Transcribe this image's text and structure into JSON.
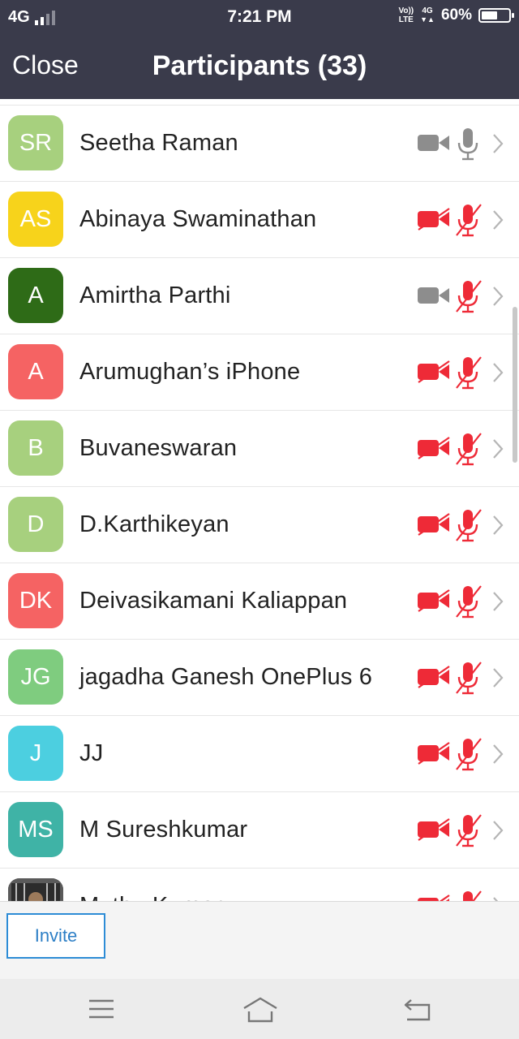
{
  "status_bar": {
    "network": "4G",
    "time": "7:21 PM",
    "volte_top": "Vo))",
    "volte_bottom": "LTE",
    "net_right": "4G",
    "battery": "60%",
    "battery_level": 0.6
  },
  "header": {
    "close_label": "Close",
    "title": "Participants (33)"
  },
  "colors": {
    "header_bg": "#3a3b4b",
    "muted_red": "#ee2a37",
    "active_gray": "#8d8d8d",
    "invite_blue": "#2d8cd6"
  },
  "participants": [
    {
      "initials": "SR",
      "name": "Seetha Raman",
      "avatar_color": "#a7d07e",
      "video": "on",
      "audio": "on"
    },
    {
      "initials": "AS",
      "name": "Abinaya Swaminathan",
      "avatar_color": "#f7d31b",
      "video": "off",
      "audio": "off"
    },
    {
      "initials": "A",
      "name": "Amirtha Parthi",
      "avatar_color": "#2e6b17",
      "video": "on",
      "audio": "off"
    },
    {
      "initials": "A",
      "name": "Arumughan’s iPhone",
      "avatar_color": "#f56363",
      "video": "off",
      "audio": "off"
    },
    {
      "initials": "B",
      "name": "Buvaneswaran",
      "avatar_color": "#a7d07e",
      "video": "off",
      "audio": "off"
    },
    {
      "initials": "D",
      "name": "D.Karthikeyan",
      "avatar_color": "#a7d07e",
      "video": "off",
      "audio": "off"
    },
    {
      "initials": "DK",
      "name": "Deivasikamani Kaliappan",
      "avatar_color": "#f56363",
      "video": "off",
      "audio": "off"
    },
    {
      "initials": "JG",
      "name": "jagadha Ganesh OnePlus 6",
      "avatar_color": "#7fcc7f",
      "video": "off",
      "audio": "off"
    },
    {
      "initials": "J",
      "name": "JJ",
      "avatar_color": "#4ccfe0",
      "video": "off",
      "audio": "off"
    },
    {
      "initials": "MS",
      "name": "M Sureshkumar",
      "avatar_color": "#3fb3a6",
      "video": "off",
      "audio": "off"
    },
    {
      "initials": "",
      "name": "Muthu Kumar",
      "avatar_color": "#6b6b6b",
      "video": "off",
      "audio": "off",
      "photo": true
    }
  ],
  "footer": {
    "invite_label": "Invite"
  },
  "nav_icons": [
    "menu-icon",
    "home-icon",
    "back-icon"
  ]
}
